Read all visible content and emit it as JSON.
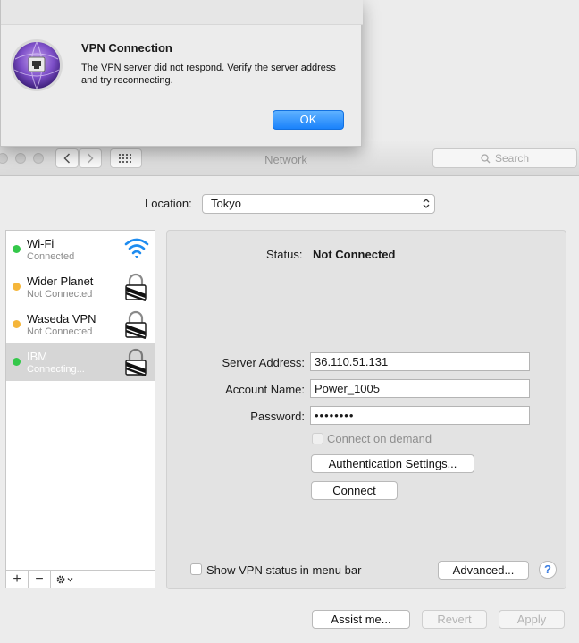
{
  "alert": {
    "title": "VPN Connection",
    "message": "The VPN server did not respond. Verify the server address and try reconnecting.",
    "ok_label": "OK"
  },
  "window": {
    "title": "Network",
    "search_placeholder": "Search"
  },
  "location": {
    "label": "Location:",
    "value": "Tokyo"
  },
  "services": [
    {
      "name": "Wi-Fi",
      "status": "Connected",
      "dot_color": "#34c84a",
      "icon": "wifi-icon"
    },
    {
      "name": "Wider Planet",
      "status": "Not Connected",
      "dot_color": "#f5b63a",
      "icon": "vpn-lock-icon"
    },
    {
      "name": "Waseda VPN",
      "status": "Not Connected",
      "dot_color": "#f5b63a",
      "icon": "vpn-lock-icon"
    },
    {
      "name": "IBM",
      "status": "Connecting...",
      "dot_color": "#34c84a",
      "icon": "vpn-lock-icon",
      "selected": true
    }
  ],
  "sidebar_controls": {
    "add": "+",
    "remove": "−"
  },
  "detail": {
    "status_label": "Status:",
    "status_value": "Not Connected",
    "server_label": "Server Address:",
    "server_value": "36.110.51.131",
    "account_label": "Account Name:",
    "account_value": "Power_1005",
    "password_label": "Password:",
    "password_value": "••••••••",
    "connect_on_demand": "Connect on demand",
    "auth_button": "Authentication Settings...",
    "connect_button": "Connect",
    "show_status": "Show VPN status in menu bar",
    "advanced_button": "Advanced...",
    "help": "?"
  },
  "footer": {
    "assist": "Assist me...",
    "revert": "Revert",
    "apply": "Apply"
  },
  "colors": {
    "accent": "#1a82fb",
    "connected": "#34c84a",
    "not_connected": "#f5b63a"
  }
}
